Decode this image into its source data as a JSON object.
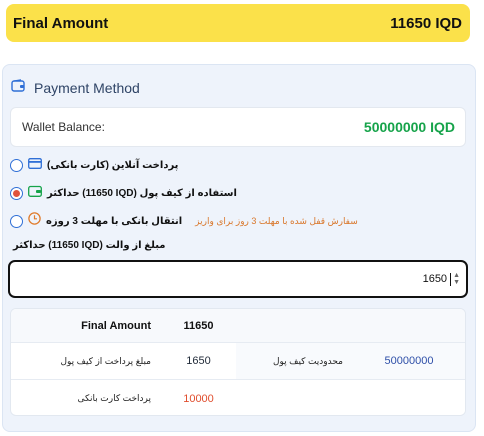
{
  "final": {
    "label": "Final Amount",
    "amount": "11650 IQD"
  },
  "payment": {
    "title": "Payment Method",
    "wallet_balance_label": "Wallet Balance:",
    "wallet_balance_value": "50000000 IQD",
    "options": [
      {
        "label": "پرداخت آنلاین (کارت بانکی)",
        "note": ""
      },
      {
        "label": "حداکثر (11650 IQD) استفاده از کیف پول",
        "note": ""
      },
      {
        "label": "انتقال بانکی با مهلت 3 روزه",
        "note": "سفارش قفل شده با مهلت 3 روز برای واریز"
      }
    ],
    "wallet_amount_label": "حداکثر (11650 IQD) مبلغ از والت",
    "wallet_amount_value": "1650"
  },
  "summary": {
    "row1": {
      "label": "Final Amount",
      "value": "11650"
    },
    "row2": {
      "label": "مبلغ پرداخت از کیف پول",
      "value": "1650",
      "label2": "محدودیت کیف پول",
      "value2": "50000000"
    },
    "row3": {
      "label": "پرداخت کارت بانکی",
      "value": "10000"
    }
  },
  "colors": {
    "accent": "#fbe14a",
    "balance": "#16a34a",
    "limit": "#2e4fa8",
    "card": "#e04e2e",
    "note": "#d9772b"
  }
}
